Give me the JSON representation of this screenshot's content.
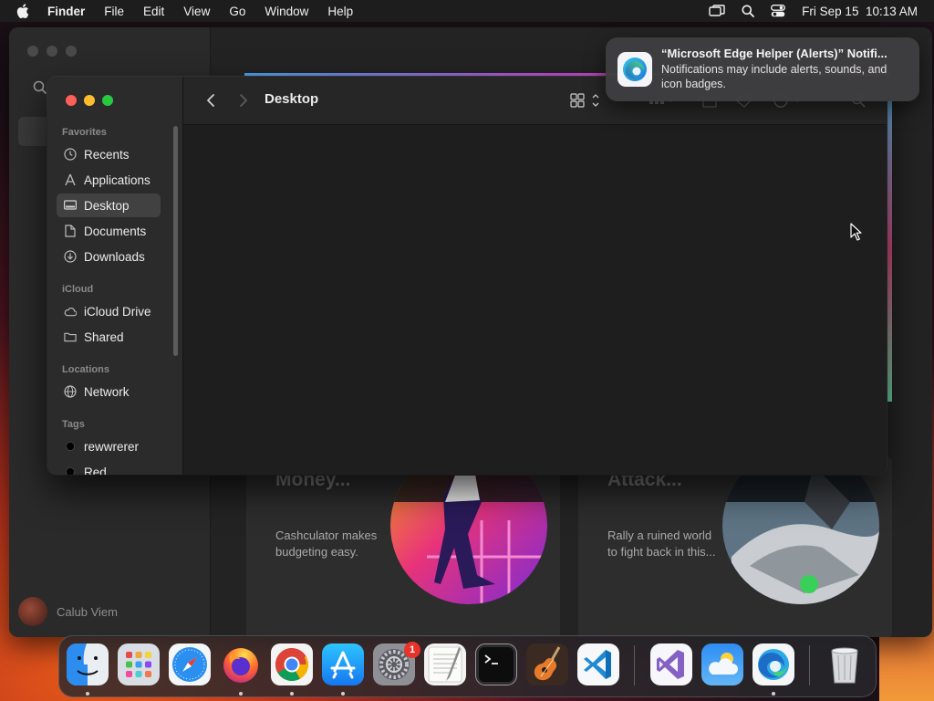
{
  "menubar": {
    "app_name": "Finder",
    "items": [
      "File",
      "Edit",
      "View",
      "Go",
      "Window",
      "Help"
    ],
    "datetime": "Fri Sep 15  10:13 AM"
  },
  "notification": {
    "title": "“Microsoft Edge Helper (Alerts)” Notifi...",
    "body": "Notifications may include alerts, sounds, and icon badges.",
    "icon": "microsoft-edge-icon"
  },
  "finder": {
    "title": "Desktop",
    "sections": {
      "favorites": "Favorites",
      "icloud": "iCloud",
      "locations": "Locations",
      "tags": "Tags"
    },
    "favorites": [
      {
        "label": "Recents",
        "icon": "clock-icon"
      },
      {
        "label": "Applications",
        "icon": "applications-icon"
      },
      {
        "label": "Desktop",
        "icon": "desktop-icon",
        "selected": true
      },
      {
        "label": "Documents",
        "icon": "document-icon"
      },
      {
        "label": "Downloads",
        "icon": "download-icon"
      }
    ],
    "icloud": [
      {
        "label": "iCloud Drive",
        "icon": "cloud-icon"
      },
      {
        "label": "Shared",
        "icon": "shared-folder-icon"
      }
    ],
    "locations": [
      {
        "label": "Network",
        "icon": "globe-icon"
      }
    ],
    "tags": [
      {
        "label": "rewwrerer",
        "color": "#000000"
      },
      {
        "label": "Red",
        "color": "#000000"
      }
    ]
  },
  "appstore": {
    "user_name": "Calub Viem",
    "cards": [
      {
        "title": "Money...",
        "description": "Cashculator makes budgeting easy."
      },
      {
        "title": "Attack...",
        "description": "Rally a ruined world to fight back in this..."
      }
    ]
  },
  "dock": {
    "apps": [
      "Finder",
      "Launchpad",
      "Safari",
      "Firefox",
      "Chrome",
      "App Store",
      "System Settings",
      "TextEdit",
      "Terminal",
      "GarageBand",
      "Visual Studio Code",
      "Visual Studio",
      "Weather",
      "Microsoft Edge",
      "Trash"
    ],
    "system_settings_badge": "1"
  }
}
